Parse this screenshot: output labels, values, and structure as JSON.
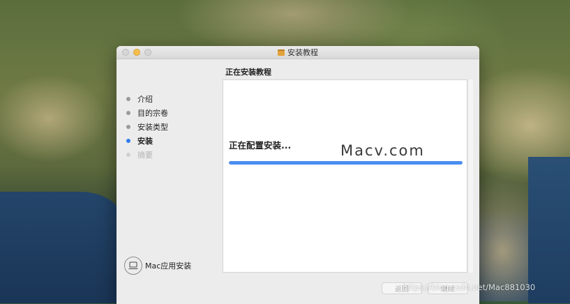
{
  "window": {
    "title": "安装教程",
    "heading": "正在安装教程"
  },
  "sidebar": {
    "steps": [
      {
        "label": "介绍",
        "state": "done"
      },
      {
        "label": "目的宗卷",
        "state": "done"
      },
      {
        "label": "安装类型",
        "state": "done"
      },
      {
        "label": "安装",
        "state": "active"
      },
      {
        "label": "摘要",
        "state": "pending"
      }
    ],
    "brand_label": "Mac应用安装"
  },
  "install": {
    "status_text": "正在配置安装...",
    "progress_fraction": 1.0
  },
  "footer": {
    "back_label": "返回",
    "next_label": "继续"
  },
  "watermark": {
    "logo_text": "Macv.com",
    "url_text": "https://blog.csdn.net/Mac881030"
  },
  "colors": {
    "accent": "#2f7bf2",
    "progress": "#4a8df0",
    "minimize": "#f5bf4f"
  }
}
